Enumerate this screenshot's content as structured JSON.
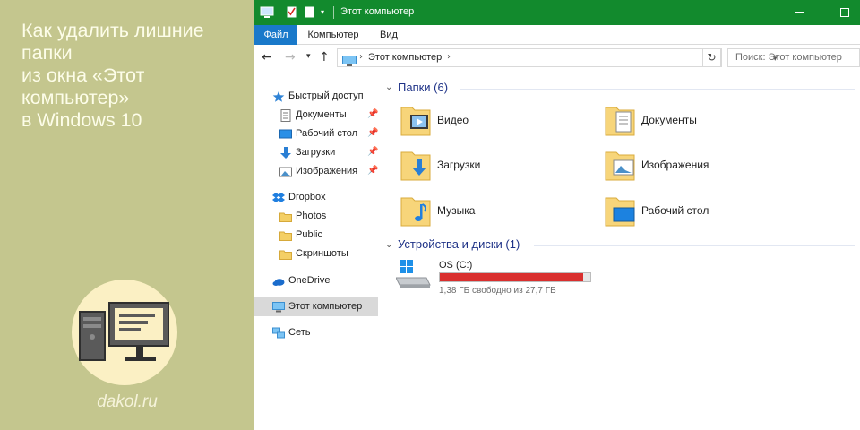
{
  "promo": {
    "title_line1": "Как удалить лишние папки",
    "title_line2": "из окна «Этот компьютер»",
    "title_line3": "в Windows 10",
    "site": "dakol.ru"
  },
  "window": {
    "title": "Этот компьютер",
    "titlebar_color": "#128a2d"
  },
  "ribbon": {
    "tabs": [
      {
        "label": "Файл",
        "active": true
      },
      {
        "label": "Компьютер",
        "active": false
      },
      {
        "label": "Вид",
        "active": false
      }
    ],
    "accent": "#1979ca"
  },
  "address": {
    "path": "Этот компьютер",
    "search_placeholder": "Поиск: Этот компьютер"
  },
  "navpane": {
    "quick_access": "Быстрый доступ",
    "quick_items": [
      "Документы",
      "Рабочий стол",
      "Загрузки",
      "Изображения"
    ],
    "dropbox": "Dropbox",
    "dropbox_items": [
      "Photos",
      "Public",
      "Скриншоты"
    ],
    "onedrive": "OneDrive",
    "this_pc": "Этот компьютер",
    "network": "Сеть"
  },
  "content": {
    "folders_header": "Папки (6)",
    "folders": [
      "Видео",
      "Документы",
      "Загрузки",
      "Изображения",
      "Музыка",
      "Рабочий стол"
    ],
    "devices_header": "Устройства и диски (1)",
    "drive": {
      "name": "OS (C:)",
      "free_text": "1,38 ГБ свободно из 27,7 ГБ",
      "used_fraction": 0.95,
      "bar_color": "#d92f2e"
    }
  }
}
